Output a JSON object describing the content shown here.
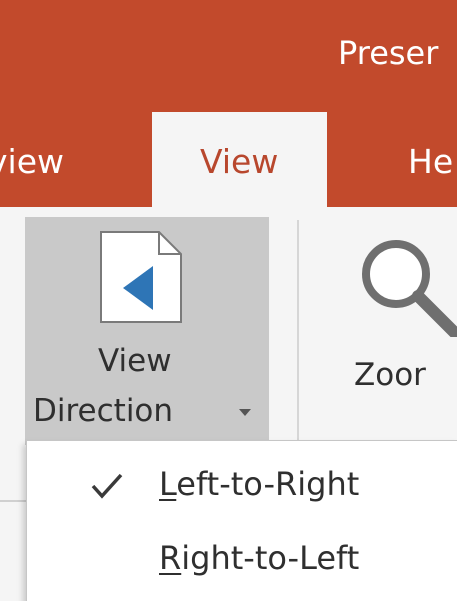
{
  "window": {
    "title_visible": "Preser"
  },
  "tabs": [
    {
      "label": "view",
      "active": false
    },
    {
      "label": "View",
      "active": true
    },
    {
      "label": "He",
      "active": false
    }
  ],
  "ribbon": {
    "view_direction": {
      "label_line1": "View",
      "label_line2": "Direction",
      "icon": "document-arrow-left-icon",
      "has_dropdown": true
    },
    "zoom": {
      "label": "Zoor",
      "icon": "magnifier-icon"
    }
  },
  "menu": {
    "items": [
      {
        "accel": "L",
        "rest": "eft-to-Right",
        "checked": true
      },
      {
        "accel": "R",
        "rest": "ight-to-Left",
        "checked": false
      }
    ]
  },
  "colors": {
    "title_bar": "#c24a2c",
    "active_tab_text": "#b8472d",
    "ribbon_bg": "#f5f5f5",
    "selected_group_bg": "#c9c9c9",
    "arrow_blue": "#2e75b6"
  }
}
